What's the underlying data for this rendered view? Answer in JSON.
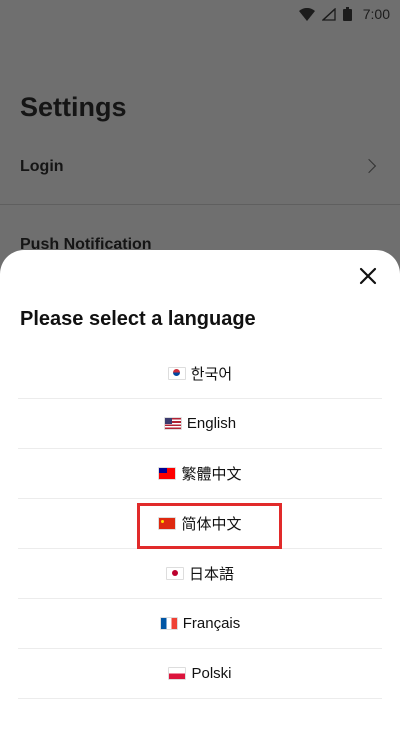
{
  "status_bar": {
    "time": "7:00"
  },
  "settings": {
    "title": "Settings",
    "rows": [
      {
        "label": "Login"
      },
      {
        "label": "Push Notification"
      }
    ]
  },
  "language_sheet": {
    "title": "Please select a language",
    "languages": [
      {
        "label": "한국어",
        "flag": "kr-flag-icon"
      },
      {
        "label": "English",
        "flag": "us-flag-icon"
      },
      {
        "label": "繁體中文",
        "flag": "tw-flag-icon"
      },
      {
        "label": "简体中文",
        "flag": "cn-flag-icon",
        "highlighted": true
      },
      {
        "label": "日本語",
        "flag": "jp-flag-icon"
      },
      {
        "label": "Français",
        "flag": "fr-flag-icon"
      },
      {
        "label": "Polski",
        "flag": "pl-flag-icon"
      }
    ]
  },
  "colors": {
    "overlay": "#6f6f6f",
    "sheet": "#ffffff",
    "highlight": "#e12a2a"
  }
}
